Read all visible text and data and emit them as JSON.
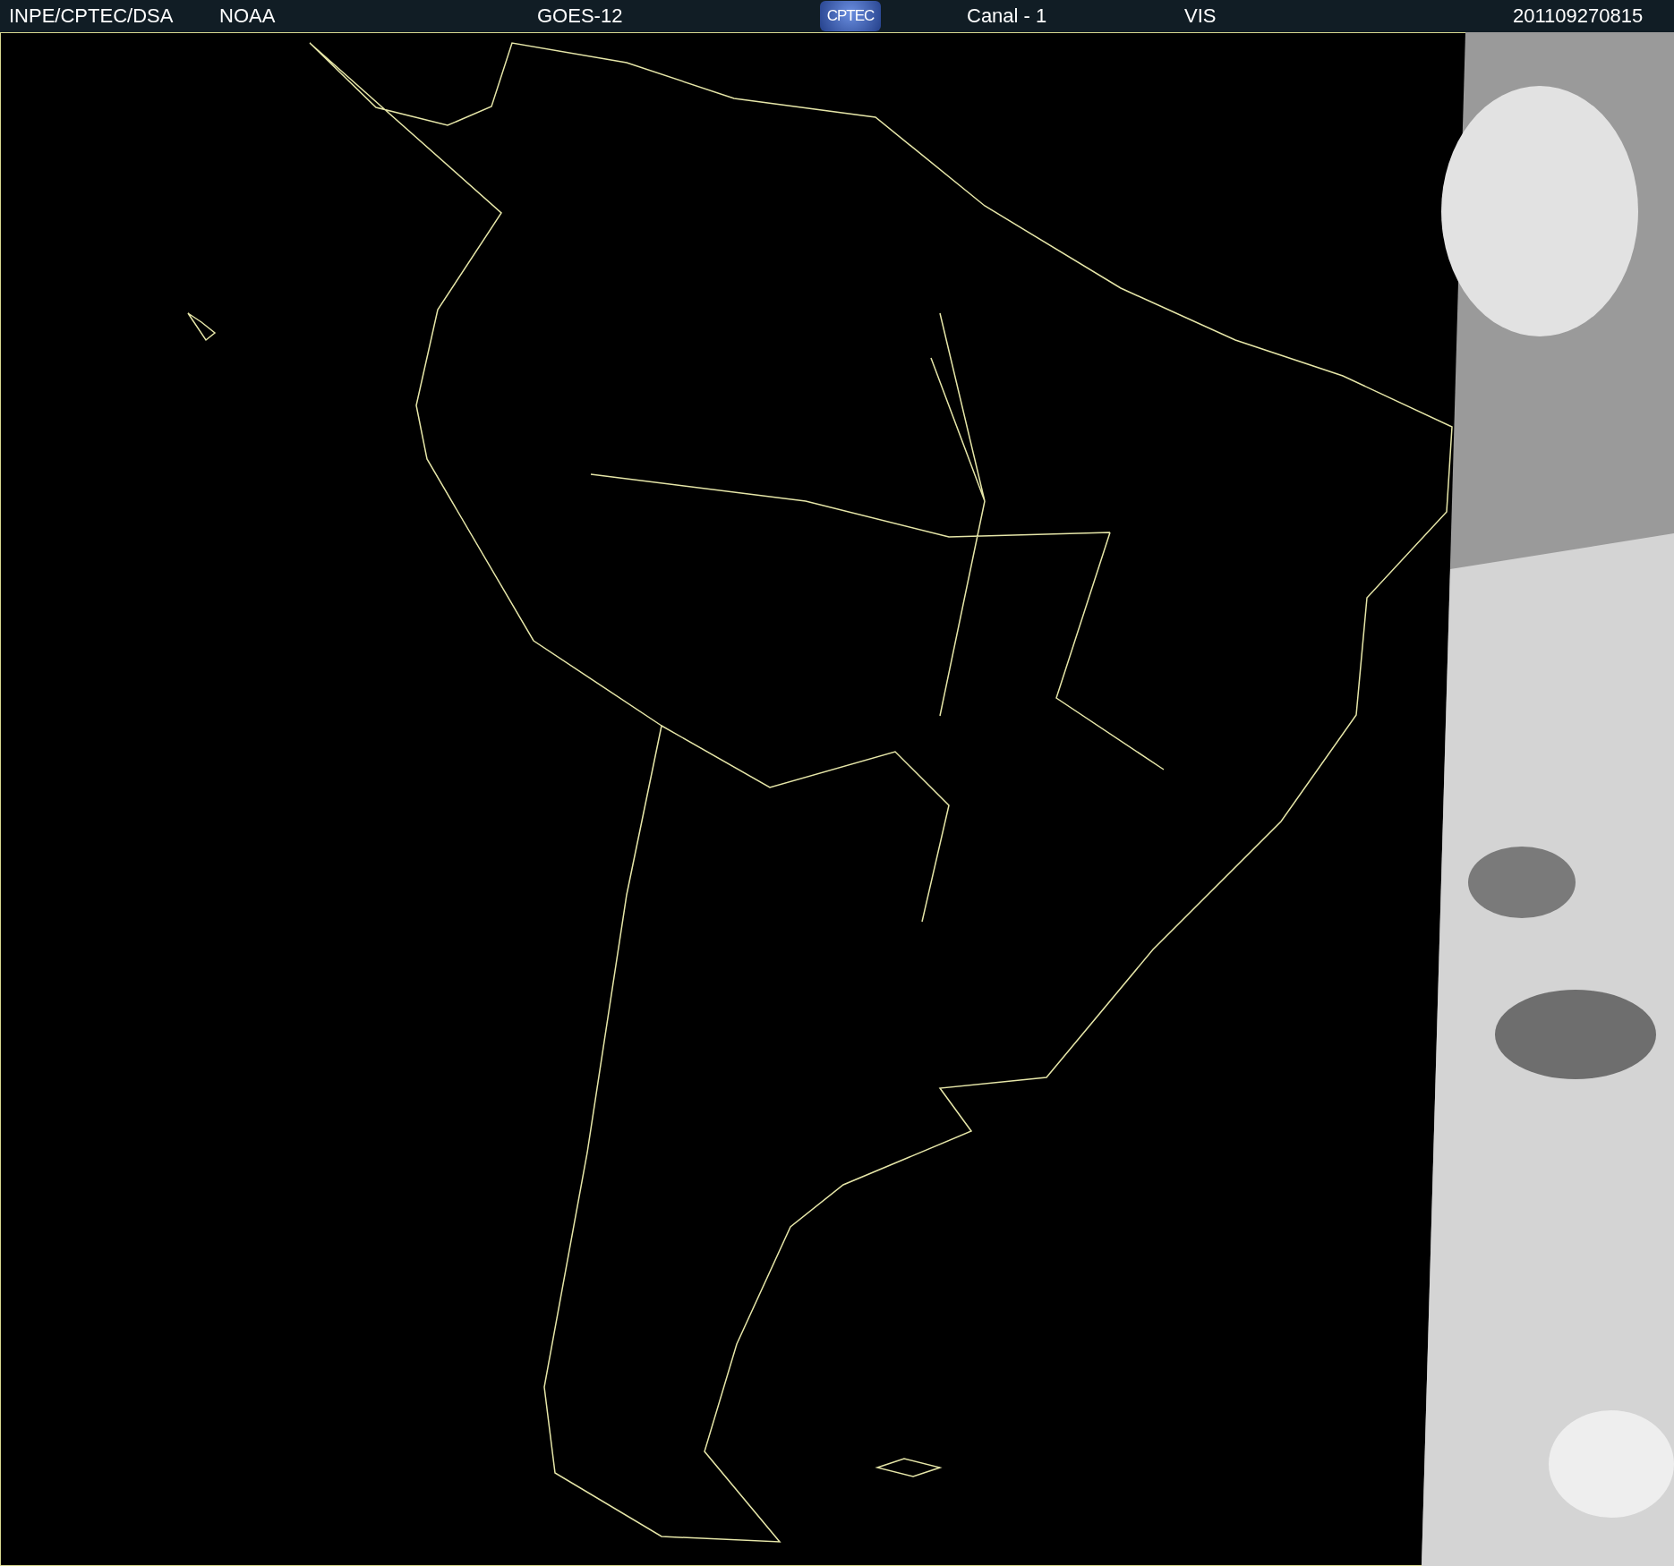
{
  "header": {
    "agency": "INPE/CPTEC/DSA",
    "source": "NOAA",
    "satellite": "GOES-12",
    "logo": "CPTEC",
    "channel": "Canal - 1",
    "band": "VIS",
    "timestamp": "201109270815"
  }
}
